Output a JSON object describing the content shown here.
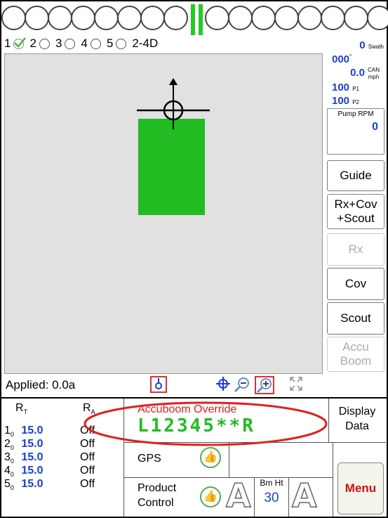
{
  "section_lights": {
    "left_count": 8,
    "right_count": 8
  },
  "product_selector": {
    "items": [
      {
        "label": "1",
        "checked": true
      },
      {
        "label": "2",
        "checked": false
      },
      {
        "label": "3",
        "checked": false
      },
      {
        "label": "4",
        "checked": false
      },
      {
        "label": "5",
        "checked": false
      },
      {
        "label": "2-4D",
        "checked": false
      }
    ]
  },
  "status_panel": {
    "swath_value": "0",
    "swath_unit": "Swath",
    "heading_value": "000",
    "heading_unit": "°",
    "speed_value": "0.0",
    "speed_unit_top": "CAN",
    "speed_unit_bottom": "mph",
    "p1_value": "100",
    "p1_label": "P1",
    "p2_value": "100",
    "p2_label": "P2",
    "pump_label": "Pump RPM",
    "pump_value": "0"
  },
  "side_buttons": {
    "guide": "Guide",
    "rx_cov_scout_line1": "Rx+Cov",
    "rx_cov_scout_line2": "+Scout",
    "rx": "Rx",
    "cov": "Cov",
    "scout": "Scout",
    "accuboom_line1": "Accu",
    "accuboom_line2": "Boom"
  },
  "applied": {
    "label": "Applied: 0.0a"
  },
  "rates": {
    "header_target": "R",
    "header_target_sub": "T",
    "header_actual": "R",
    "header_actual_sub": "A",
    "rows": [
      {
        "num": "1",
        "sub": "0",
        "target": "15.0",
        "actual": "Off"
      },
      {
        "num": "2",
        "sub": "0",
        "target": "15.0",
        "actual": "Off"
      },
      {
        "num": "3",
        "sub": "0",
        "target": "15.0",
        "actual": "Off"
      },
      {
        "num": "4",
        "sub": "0",
        "target": "15.0",
        "actual": "Off"
      },
      {
        "num": "5",
        "sub": "0",
        "target": "15.0",
        "actual": "Off"
      }
    ]
  },
  "accuboom": {
    "title": "Accuboom Override",
    "sections": "L12345**R"
  },
  "display_data": {
    "line1": "Display",
    "line2": "Data"
  },
  "gps": {
    "label": "GPS"
  },
  "product_control": {
    "line1": "Product",
    "line2": "Control"
  },
  "boom_height": {
    "label": "Bm Ht",
    "value": "30"
  },
  "menu": {
    "label": "Menu"
  },
  "colors": {
    "accent_blue": "#1a3fd6",
    "coverage_green": "#22bb22",
    "override_red": "#e02020",
    "section_green": "#22cc22"
  }
}
